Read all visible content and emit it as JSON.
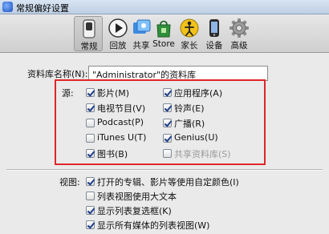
{
  "window": {
    "title": "常规偏好设置"
  },
  "toolbar": {
    "items": [
      {
        "label": "常规",
        "icon": "general-switch-icon",
        "selected": true
      },
      {
        "label": "回放",
        "icon": "play-icon",
        "selected": false
      },
      {
        "label": "共享",
        "icon": "share-icon",
        "selected": false
      },
      {
        "label": "Store",
        "icon": "store-bag-icon",
        "selected": false
      },
      {
        "label": "家长",
        "icon": "parental-icon",
        "selected": false
      },
      {
        "label": "设备",
        "icon": "device-icon",
        "selected": false
      },
      {
        "label": "高级",
        "icon": "gear-icon",
        "selected": false
      }
    ]
  },
  "library": {
    "label": "资料库名称(N):",
    "value": "\"Administrator\"的资料库"
  },
  "sources": {
    "label": "源:",
    "items": [
      {
        "label": "影片(M)",
        "checked": true,
        "enabled": true
      },
      {
        "label": "应用程序(A)",
        "checked": true,
        "enabled": true
      },
      {
        "label": "电视节目(V)",
        "checked": true,
        "enabled": true
      },
      {
        "label": "铃声(E)",
        "checked": true,
        "enabled": true
      },
      {
        "label": "Podcast(P)",
        "checked": false,
        "enabled": true
      },
      {
        "label": "广播(R)",
        "checked": true,
        "enabled": true
      },
      {
        "label": "iTunes U(T)",
        "checked": false,
        "enabled": true
      },
      {
        "label": "Genius(U)",
        "checked": true,
        "enabled": true
      },
      {
        "label": "图书(B)",
        "checked": true,
        "enabled": true
      },
      {
        "label": "共享资料库(S)",
        "checked": false,
        "enabled": false
      }
    ]
  },
  "view": {
    "label": "视图:",
    "items": [
      {
        "label": "打开的专辑、影片等使用自定颜色(I)",
        "checked": true
      },
      {
        "label": "列表视图使用大文本",
        "checked": false
      },
      {
        "label": "显示列表复选框(K)",
        "checked": true
      },
      {
        "label": "显示所有媒体的列表视图(W)",
        "checked": true
      }
    ]
  },
  "colors": {
    "highlight": "#e0262a",
    "check": "#1f3f8a"
  }
}
